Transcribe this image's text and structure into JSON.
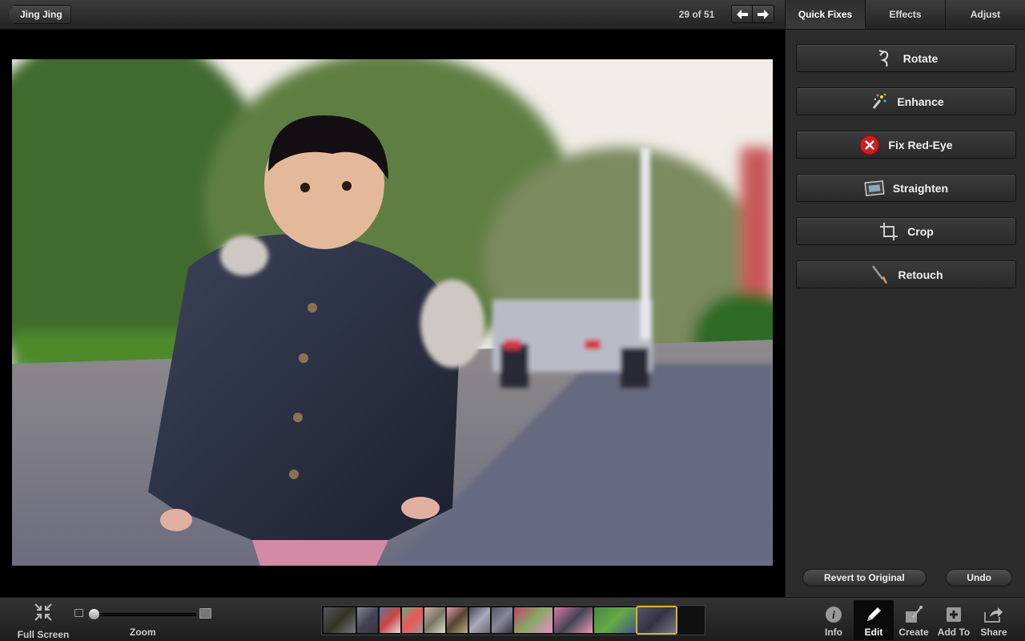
{
  "topbar": {
    "back_label": "Jing Jing",
    "counter": "29 of 51"
  },
  "panel": {
    "tabs": [
      {
        "label": "Quick Fixes",
        "active": true
      },
      {
        "label": "Effects",
        "active": false
      },
      {
        "label": "Adjust",
        "active": false
      }
    ],
    "fixes": [
      {
        "label": "Rotate",
        "icon": "rotate-icon"
      },
      {
        "label": "Enhance",
        "icon": "magic-wand-icon"
      },
      {
        "label": "Fix Red-Eye",
        "icon": "red-eye-icon"
      },
      {
        "label": "Straighten",
        "icon": "straighten-icon"
      },
      {
        "label": "Crop",
        "icon": "crop-icon"
      },
      {
        "label": "Retouch",
        "icon": "brush-icon"
      }
    ],
    "revert_label": "Revert to Original",
    "undo_label": "Undo"
  },
  "bottombar": {
    "fullscreen_label": "Full Screen",
    "zoom_label": "Zoom",
    "zoom_level": 0.0,
    "tools": [
      {
        "label": "Info",
        "icon": "info-icon",
        "active": false
      },
      {
        "label": "Edit",
        "icon": "pencil-icon",
        "active": true
      },
      {
        "label": "Create",
        "icon": "create-icon",
        "active": false
      },
      {
        "label": "Add To",
        "icon": "plus-icon",
        "active": false
      },
      {
        "label": "Share",
        "icon": "share-icon",
        "active": false
      }
    ]
  },
  "colors": {
    "accent_selected": "#d7b332",
    "red_eye": "#c81e23"
  }
}
